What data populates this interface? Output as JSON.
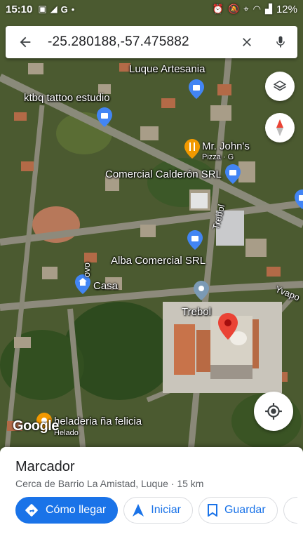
{
  "status_bar": {
    "time": "15:10",
    "left_icons": [
      "gallery-icon",
      "signal-icon",
      "google-icon",
      "dot"
    ],
    "right_icons": [
      "alarm-icon",
      "mute-icon",
      "location-icon",
      "wifi-icon",
      "signal-icon"
    ],
    "battery": "12%"
  },
  "search": {
    "query": "-25.280188,-57.475882"
  },
  "map_labels": {
    "luque_artesania": "Luque Artesania",
    "ktbq": "ktbq tattoo estudio",
    "mr_johns_1": "Mr. John's",
    "mr_johns_2": "Pizza · G",
    "comercial_calderon": "Comercial Calderón SRL",
    "trebol_road": "Trebol",
    "alba_comercial": "Alba Comercial SRL",
    "casa": "Casa",
    "trebol_place": "Trebol",
    "yvapo": "Yvapo",
    "heladeria": "heladeria ña felicia",
    "heladeria_sub": "Helado",
    "road_small": "ovo"
  },
  "logo": "Google",
  "colors": {
    "accent": "#1a73e8",
    "marker_red": "#ea4335",
    "poi_blue": "#4285f4",
    "poi_orange": "#f29900",
    "poi_gray": "#7b9ab5"
  },
  "bottom_sheet": {
    "title": "Marcador",
    "subtitle": "Cerca de Barrio La Amistad, Luque · 15 km",
    "actions": {
      "directions": "Cómo llegar",
      "start": "Iniciar",
      "save": "Guardar"
    }
  }
}
